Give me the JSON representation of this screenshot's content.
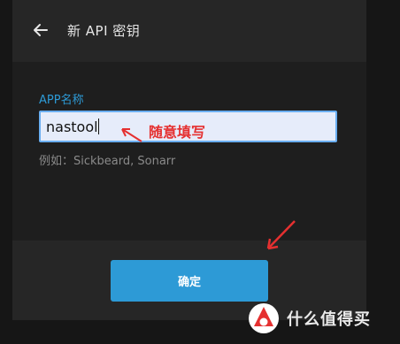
{
  "header": {
    "title": "新 API 密钥",
    "back_icon": "arrow-left-icon"
  },
  "form": {
    "field_label": "APP名称",
    "input_value": "nastool",
    "hint": "例如：Sickbeard, Sonarr"
  },
  "annotation": {
    "text": "随意填写",
    "color": "#e53030"
  },
  "footer": {
    "confirm_label": "确定"
  },
  "watermark": {
    "text": "什么值得买",
    "logo_icon": "smzdm-logo-icon"
  },
  "colors": {
    "accent": "#2d9ad6",
    "input_bg": "#e6ecfa",
    "input_border": "#6aaef0",
    "annotation": "#e53030"
  }
}
